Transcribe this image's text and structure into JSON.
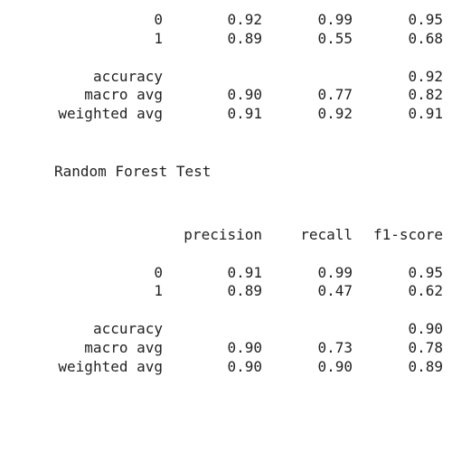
{
  "report1": {
    "rows": [
      {
        "label": "0",
        "precision": "0.92",
        "recall": "0.99",
        "f1": "0.95"
      },
      {
        "label": "1",
        "precision": "0.89",
        "recall": "0.55",
        "f1": "0.68"
      }
    ],
    "accuracy": {
      "label": "accuracy",
      "f1": "0.92"
    },
    "macro": {
      "label": "macro avg",
      "precision": "0.90",
      "recall": "0.77",
      "f1": "0.82"
    },
    "weighted": {
      "label": "weighted avg",
      "precision": "0.91",
      "recall": "0.92",
      "f1": "0.91"
    }
  },
  "section_title": "Random Forest Test",
  "report2": {
    "headers": {
      "precision": "precision",
      "recall": "recall",
      "f1": "f1-score"
    },
    "rows": [
      {
        "label": "0",
        "precision": "0.91",
        "recall": "0.99",
        "f1": "0.95"
      },
      {
        "label": "1",
        "precision": "0.89",
        "recall": "0.47",
        "f1": "0.62"
      }
    ],
    "accuracy": {
      "label": "accuracy",
      "f1": "0.90"
    },
    "macro": {
      "label": "macro avg",
      "precision": "0.90",
      "recall": "0.73",
      "f1": "0.78"
    },
    "weighted": {
      "label": "weighted avg",
      "precision": "0.90",
      "recall": "0.90",
      "f1": "0.89"
    }
  }
}
